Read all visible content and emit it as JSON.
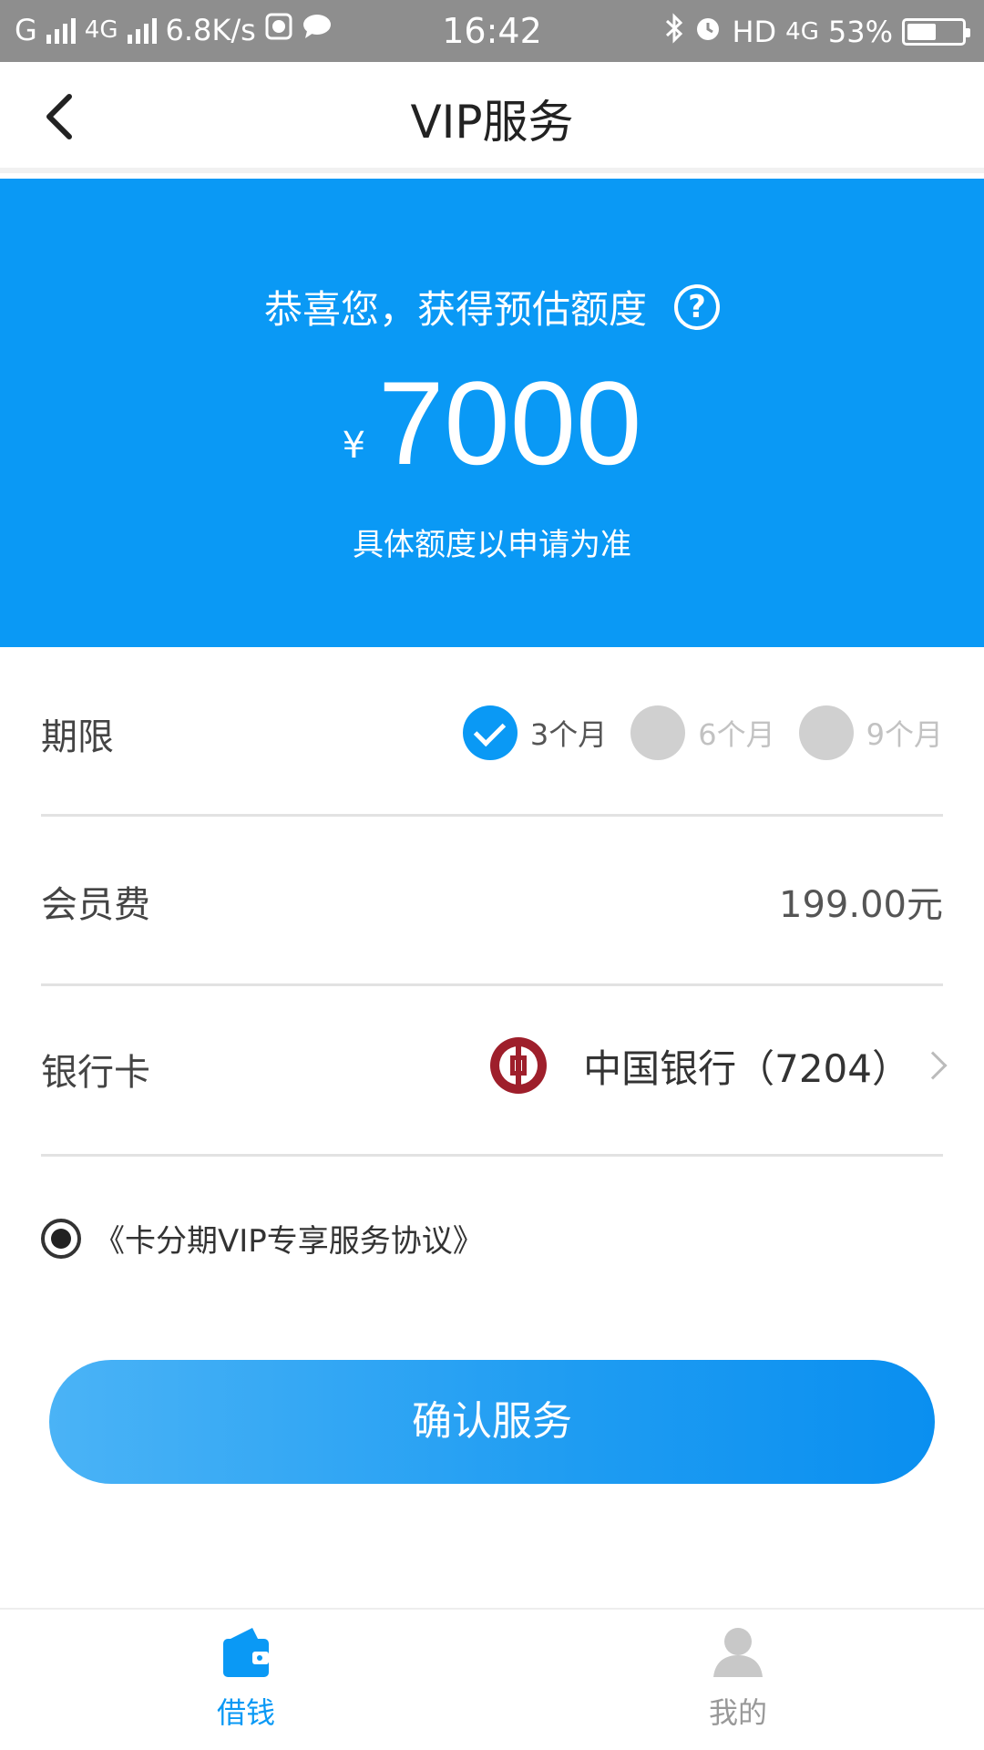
{
  "status_bar": {
    "carrier_1": "G",
    "carrier_2": "4G",
    "speed": "6.8K/s",
    "time": "16:42",
    "hd": "HD",
    "network": "4G",
    "battery": "53%",
    "battery_level": 0.53
  },
  "header": {
    "title": "VIP服务"
  },
  "hero": {
    "title": "恭喜您，获得预估额度",
    "currency": "¥",
    "amount": "7000",
    "note": "具体额度以申请为准"
  },
  "term": {
    "label": "期限",
    "options": [
      {
        "label": "3个月",
        "selected": true
      },
      {
        "label": "6个月",
        "selected": false
      },
      {
        "label": "9个月",
        "selected": false
      }
    ]
  },
  "fee": {
    "label": "会员费",
    "value": "199.00元"
  },
  "bank": {
    "label": "银行卡",
    "name": "中国银行（7204）"
  },
  "agreement": {
    "text": "《卡分期VIP专享服务协议》"
  },
  "confirm_button": "确认服务",
  "tabs": {
    "loan": "借钱",
    "mine": "我的"
  },
  "colors": {
    "primary": "#0a99f5",
    "boc_red": "#9e1f2b"
  }
}
